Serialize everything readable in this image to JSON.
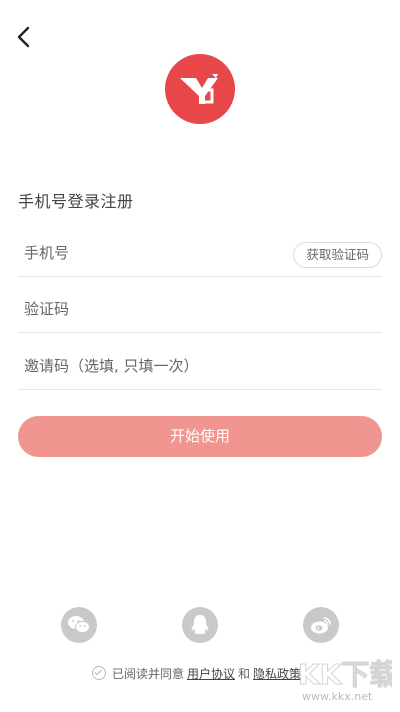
{
  "header": {
    "back_icon": "chevron-left-icon"
  },
  "logo": {
    "icon": "app-logo",
    "color": "#e8474a"
  },
  "form": {
    "title": "手机号登录注册",
    "phone_placeholder": "手机号",
    "get_code_label": "获取验证码",
    "code_placeholder": "验证码",
    "invite_placeholder": "邀请码（选填, 只填一次）",
    "submit_label": "开始使用",
    "submit_color": "#f0958f"
  },
  "social": {
    "items": [
      {
        "icon": "wechat-icon"
      },
      {
        "icon": "qq-icon"
      },
      {
        "icon": "weibo-icon"
      }
    ]
  },
  "agreement": {
    "prefix": "已阅读并同意",
    "user_agreement": "用户协议",
    "and": "和",
    "privacy_policy": "隐私政策"
  },
  "watermark": {
    "text": "KK下载",
    "url": "www.kkx.net"
  }
}
